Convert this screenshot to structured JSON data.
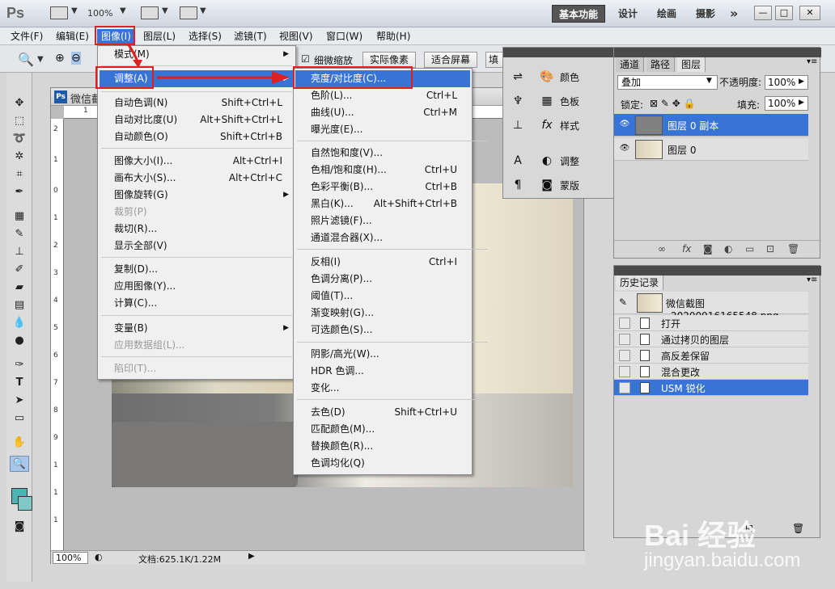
{
  "app": {
    "logo": "Ps",
    "zoom": "100%"
  },
  "workspaces": {
    "basic": "基本功能",
    "design": "设计",
    "paint": "绘画",
    "photo": "摄影",
    "more": "»"
  },
  "window_controls": {
    "minimize": "—",
    "maximize": "□",
    "close": "✕"
  },
  "menubar": {
    "items": [
      "文件(F)",
      "编辑(E)",
      "图像(I)",
      "图层(L)",
      "选择(S)",
      "滤镜(T)",
      "视图(V)",
      "窗口(W)",
      "帮助(H)"
    ]
  },
  "options": {
    "fine_zoom": "细微缩放",
    "actual_pixels": "实际像素",
    "fit_screen": "适合屏幕",
    "fill_screen": "填"
  },
  "document": {
    "title": "微信截",
    "status_zoom": "100%",
    "status_doc": "文档:625.1K/1.22M",
    "ruler_h": [
      "1"
    ],
    "ruler_v": [
      "2",
      "1",
      "0",
      "1",
      "2",
      "3",
      "4",
      "5",
      "6",
      "7",
      "8",
      "9",
      "1",
      "1",
      "1"
    ]
  },
  "image_menu": {
    "mode": "模式(M)",
    "adjust": "调整(A)",
    "auto_tone": "自动色调(N)",
    "auto_tone_sc": "Shift+Ctrl+L",
    "auto_contrast": "自动对比度(U)",
    "auto_contrast_sc": "Alt+Shift+Ctrl+L",
    "auto_color": "自动颜色(O)",
    "auto_color_sc": "Shift+Ctrl+B",
    "image_size": "图像大小(I)...",
    "image_size_sc": "Alt+Ctrl+I",
    "canvas_size": "画布大小(S)...",
    "canvas_size_sc": "Alt+Ctrl+C",
    "rotation": "图像旋转(G)",
    "crop": "裁剪(P)",
    "trim": "裁切(R)...",
    "reveal_all": "显示全部(V)",
    "duplicate": "复制(D)...",
    "apply_image": "应用图像(Y)...",
    "calculations": "计算(C)...",
    "variables": "变量(B)",
    "apply_dataset": "应用数据组(L)...",
    "trap": "陷印(T)..."
  },
  "adjust_menu": {
    "brightness": "亮度/对比度(C)...",
    "levels": "色阶(L)...",
    "levels_sc": "Ctrl+L",
    "curves": "曲线(U)...",
    "curves_sc": "Ctrl+M",
    "exposure": "曝光度(E)...",
    "vibrance": "自然饱和度(V)...",
    "hue_sat": "色相/饱和度(H)...",
    "hue_sat_sc": "Ctrl+U",
    "color_balance": "色彩平衡(B)...",
    "color_balance_sc": "Ctrl+B",
    "bw": "黑白(K)...",
    "bw_sc": "Alt+Shift+Ctrl+B",
    "photo_filter": "照片滤镜(F)...",
    "channel_mixer": "通道混合器(X)...",
    "invert": "反相(I)",
    "invert_sc": "Ctrl+I",
    "posterize": "色调分离(P)...",
    "threshold": "阈值(T)...",
    "gradient_map": "渐变映射(G)...",
    "selective_color": "可选颜色(S)...",
    "shadows": "阴影/高光(W)...",
    "hdr": "HDR 色调...",
    "variations": "变化...",
    "desaturate": "去色(D)",
    "desaturate_sc": "Shift+Ctrl+U",
    "match_color": "匹配颜色(M)...",
    "replace_color": "替换颜色(R)...",
    "equalize": "色调均化(Q)"
  },
  "dock": {
    "color": "颜色",
    "swatches": "色板",
    "styles": "样式",
    "adjustments": "调整",
    "masks": "蒙版"
  },
  "layers": {
    "tabs": [
      "通道",
      "路径",
      "图层"
    ],
    "blend": "叠加",
    "opacity_label": "不透明度:",
    "opacity": "100%",
    "lock_label": "锁定:",
    "fill_label": "填充:",
    "fill": "100%",
    "rows": [
      "图层 0 副本",
      "图层 0"
    ]
  },
  "history": {
    "tab": "历史记录",
    "snapshot": "微信截图_20200916165548.png",
    "rows": [
      "打开",
      "通过拷贝的图层",
      "高反差保留",
      "混合更改",
      "USM 锐化"
    ]
  },
  "watermark": {
    "main": "Bai 经验",
    "sub": "jingyan.baidu.com"
  }
}
